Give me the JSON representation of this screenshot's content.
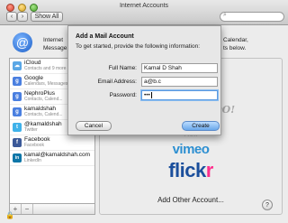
{
  "window": {
    "title": "Internet Accounts"
  },
  "toolbar": {
    "back": "‹",
    "forward": "›",
    "show_all": "Show All",
    "search_placeholder": ""
  },
  "header": {
    "left_text": "Internet\nMessage",
    "right_text": "Calendar,\nts below."
  },
  "accounts": [
    {
      "name": "iCloud",
      "sub": "Contacts and 9 more",
      "icon": "cloud-icon",
      "color": "#5aa7e6",
      "glyph": "☁"
    },
    {
      "name": "Google",
      "sub": "Calendars, Messages",
      "icon": "google-icon",
      "color": "#4a7fe0",
      "glyph": "g"
    },
    {
      "name": "NephroPlus",
      "sub": "Contacts, Calend...",
      "icon": "google-icon",
      "color": "#4a7fe0",
      "glyph": "g"
    },
    {
      "name": "kamaldshah",
      "sub": "Contacts, Calend...",
      "icon": "google-icon",
      "color": "#4a7fe0",
      "glyph": "g"
    },
    {
      "name": "@kamaldshah",
      "sub": "Twitter",
      "icon": "twitter-icon",
      "color": "#3fb2ea",
      "glyph": "t"
    },
    {
      "name": "Facebook",
      "sub": "Facebook",
      "icon": "facebook-icon",
      "color": "#3b5998",
      "glyph": "f"
    },
    {
      "name": "kamal@kamaldshah.com",
      "sub": "LinkedIn",
      "icon": "linkedin-icon",
      "color": "#0e76a8",
      "glyph": "in"
    }
  ],
  "list_controls": {
    "add": "+",
    "remove": "−"
  },
  "providers": {
    "yahoo": "YAHOO!",
    "aol": "Aol.",
    "vimeo": "vimeo",
    "flickr_a": "flick",
    "flickr_b": "r",
    "add_other": "Add Other Account..."
  },
  "help": "?",
  "sheet": {
    "title": "Add a Mail Account",
    "intro": "To get started, provide the following information:",
    "full_name_label": "Full Name:",
    "full_name_value": "Kamal D Shah",
    "email_label": "Email Address:",
    "email_value": "a@b.c",
    "password_label": "Password:",
    "password_value": "•••",
    "cancel_label": "Cancel",
    "create_label": "Create"
  }
}
